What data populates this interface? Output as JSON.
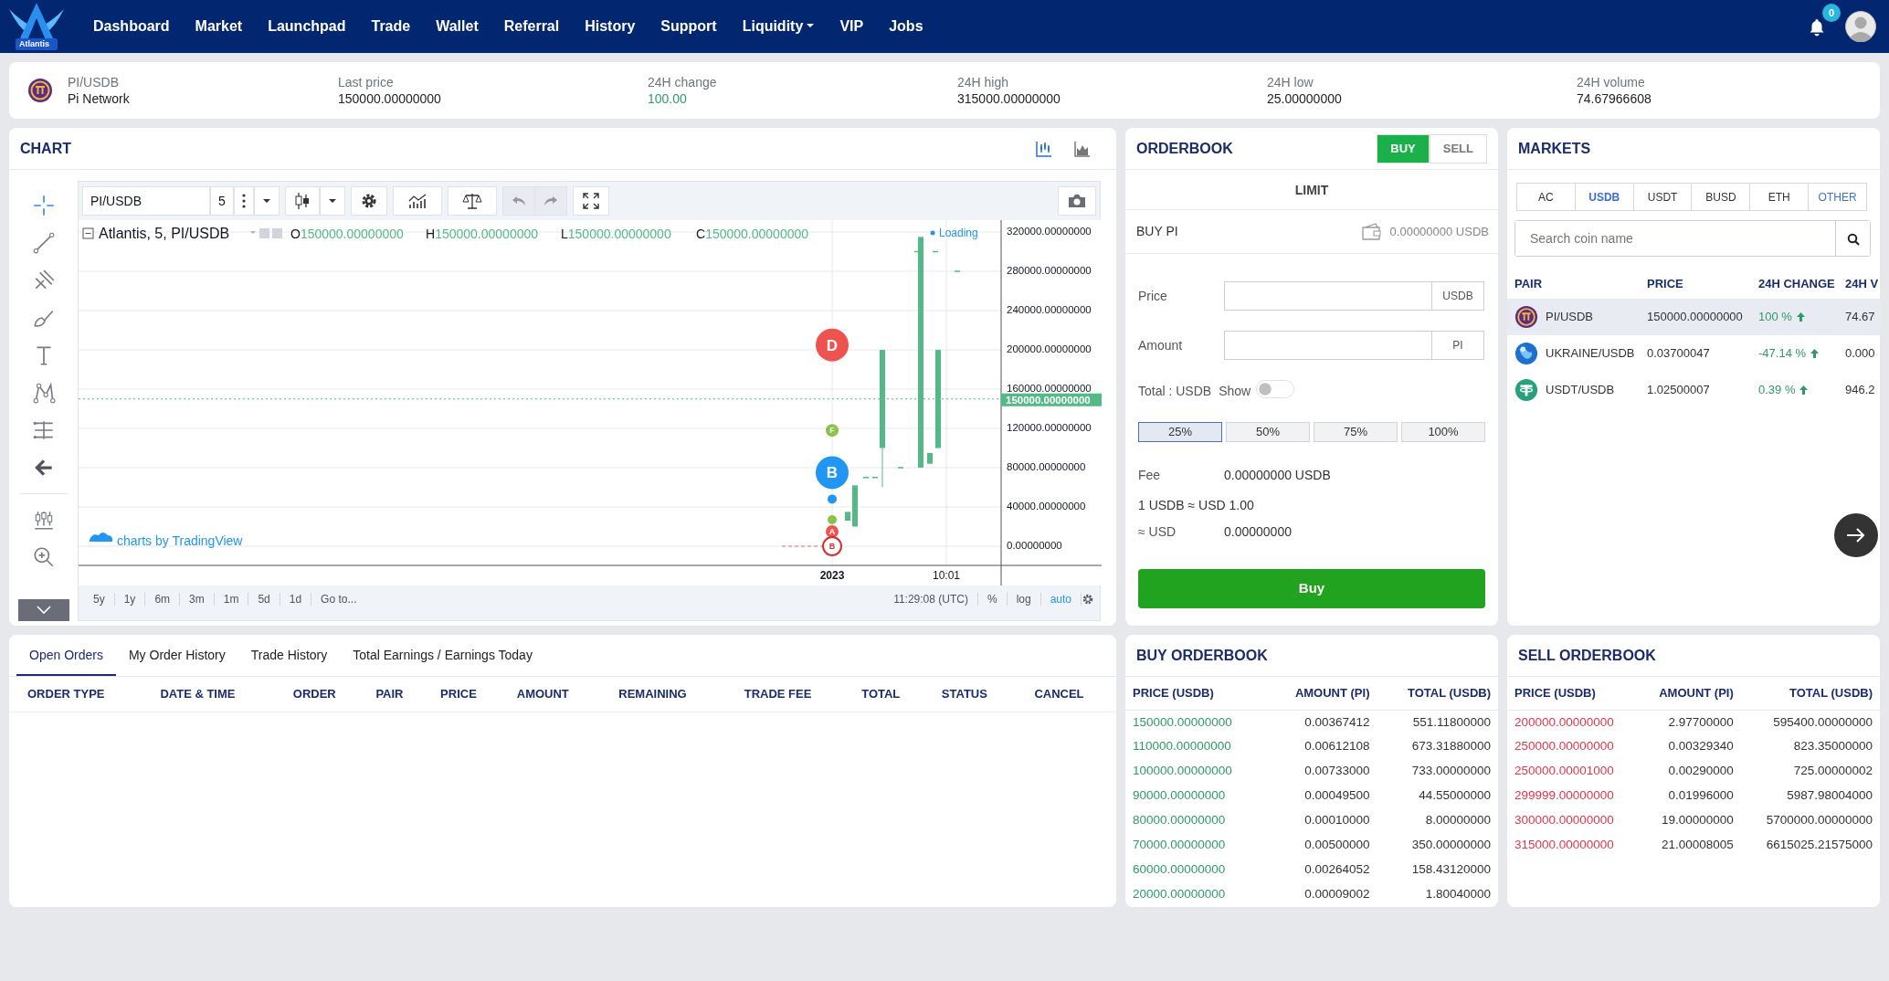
{
  "nav": {
    "brand": "Atlantis",
    "items": [
      {
        "label": "Dashboard",
        "dropdown": false
      },
      {
        "label": "Market",
        "dropdown": false
      },
      {
        "label": "Launchpad",
        "dropdown": false
      },
      {
        "label": "Trade",
        "dropdown": false
      },
      {
        "label": "Wallet",
        "dropdown": false
      },
      {
        "label": "Referral",
        "dropdown": false
      },
      {
        "label": "History",
        "dropdown": false
      },
      {
        "label": "Support",
        "dropdown": false
      },
      {
        "label": "Liquidity",
        "dropdown": true
      },
      {
        "label": "VIP",
        "dropdown": false
      },
      {
        "label": "Jobs",
        "dropdown": false
      }
    ],
    "notification_count": "0"
  },
  "ticker": {
    "pair": "PI/USDB",
    "name": "Pi Network",
    "stats": [
      {
        "label": "Last price",
        "value": "150000.00000000",
        "kind": "plain"
      },
      {
        "label": "24H change",
        "value": "100.00",
        "kind": "up"
      },
      {
        "label": "24H high",
        "value": "315000.00000000",
        "kind": "plain"
      },
      {
        "label": "24H low",
        "value": "25.00000000",
        "kind": "plain"
      },
      {
        "label": "24H volume",
        "value": "74.67966608",
        "kind": "plain"
      }
    ]
  },
  "chart": {
    "title": "CHART",
    "symbol": "PI/USDB",
    "interval": "5",
    "legend": "Atlantis, 5, PI/USDB",
    "ohlc": [
      {
        "key": "O",
        "value": "150000.00000000"
      },
      {
        "key": "H",
        "value": "150000.00000000"
      },
      {
        "key": "L",
        "value": "150000.00000000"
      },
      {
        "key": "C",
        "value": "150000.00000000"
      }
    ],
    "loading": "Loading",
    "watermark": "charts by TradingView",
    "y_labels": [
      "320000.00000000",
      "280000.00000000",
      "240000.00000000",
      "200000.00000000",
      "160000.00000000",
      "120000.00000000",
      "80000.00000000",
      "40000.00000000",
      "0.00000000"
    ],
    "price_tag": "150000.00000000",
    "x_labels": [
      "2023",
      "10:01"
    ],
    "markers": [
      {
        "kind": "large",
        "label": "D",
        "color": "#ef5350"
      },
      {
        "kind": "small",
        "label": "F",
        "color": "#8bc34a"
      },
      {
        "kind": "large",
        "label": "B",
        "color": "#2196f3"
      },
      {
        "kind": "dot",
        "color": "#2196f3"
      },
      {
        "kind": "dot",
        "color": "#8bc34a"
      },
      {
        "kind": "small",
        "label": "A",
        "color": "#ef5350"
      },
      {
        "kind": "outline",
        "label": "B",
        "color": "#d32f2f"
      }
    ],
    "ranges": [
      "5y",
      "1y",
      "6m",
      "3m",
      "1m",
      "5d",
      "1d"
    ],
    "goto": "Go to...",
    "time": "11:29:08 (UTC)",
    "scale_options": [
      {
        "label": "%",
        "selected": false
      },
      {
        "label": "log",
        "selected": false
      },
      {
        "label": "auto",
        "selected": true
      }
    ]
  },
  "orderbook": {
    "title": "ORDERBOOK",
    "sides": [
      {
        "label": "BUY",
        "selected": true
      },
      {
        "label": "SELL",
        "selected": false
      }
    ],
    "mode": "LIMIT",
    "heading": "BUY PI",
    "balance": "0.00000000 USDB",
    "fields": [
      {
        "label": "Price",
        "unit": "USDB"
      },
      {
        "label": "Amount",
        "unit": "PI"
      }
    ],
    "total_label": "Total : USDB",
    "show_label": "Show",
    "show_on": false,
    "percents": [
      {
        "label": "25%",
        "selected": true
      },
      {
        "label": "50%",
        "selected": false
      },
      {
        "label": "75%",
        "selected": false
      },
      {
        "label": "100%",
        "selected": false
      }
    ],
    "fee_label": "Fee",
    "fee": "0.00000000 USDB",
    "rate": "1 USDB ≈ USD 1.00",
    "usd_label": "≈ USD",
    "usd": "0.00000000",
    "submit": "Buy"
  },
  "markets": {
    "title": "MARKETS",
    "tabs": [
      {
        "label": "AC",
        "kind": "tab",
        "selected": false
      },
      {
        "label": "USDB",
        "kind": "tab",
        "selected": true
      },
      {
        "label": "USDT",
        "kind": "tab",
        "selected": false
      },
      {
        "label": "BUSD",
        "kind": "tab",
        "selected": false
      },
      {
        "label": "ETH",
        "kind": "tab",
        "selected": false
      },
      {
        "label": "OTHER",
        "kind": "link",
        "selected": false
      }
    ],
    "search": {
      "placeholder": "Search coin name"
    },
    "columns": [
      "PAIR",
      "PRICE",
      "24H CHANGE",
      "24H V"
    ],
    "rows": [
      {
        "kind": "pi",
        "pair": "PI/USDB",
        "price": "150000.00000000",
        "change": "100 %",
        "volume": "74.67",
        "selected": true
      },
      {
        "kind": "globe",
        "pair": "UKRAINE/USDB",
        "price": "0.03700047",
        "change": "-47.14 %",
        "volume": "0.000",
        "selected": false
      },
      {
        "kind": "tether",
        "pair": "USDT/USDB",
        "price": "1.02500007",
        "change": "0.39 %",
        "volume": "946.2",
        "selected": false
      }
    ]
  },
  "orders": {
    "tabs": [
      {
        "label": "Open Orders",
        "selected": true
      },
      {
        "label": "My Order History",
        "selected": false
      },
      {
        "label": "Trade History",
        "selected": false
      },
      {
        "label": "Total Earnings / Earnings Today",
        "selected": false
      }
    ],
    "columns": [
      "ORDER TYPE",
      "DATE & TIME",
      "ORDER",
      "PAIR",
      "PRICE",
      "AMOUNT",
      "REMAINING",
      "TRADE FEE",
      "TOTAL",
      "STATUS",
      "CANCEL"
    ]
  },
  "books": [
    {
      "title": "BUY ORDERBOOK",
      "kind": "buy",
      "columns": [
        "PRICE (USDB)",
        "AMOUNT (PI)",
        "TOTAL (USDB)"
      ],
      "rows": [
        {
          "price": "150000.00000000",
          "amount": "0.00367412",
          "total": "551.11800000"
        },
        {
          "price": "110000.00000000",
          "amount": "0.00612108",
          "total": "673.31880000"
        },
        {
          "price": "100000.00000000",
          "amount": "0.00733000",
          "total": "733.00000000"
        },
        {
          "price": "90000.00000000",
          "amount": "0.00049500",
          "total": "44.55000000"
        },
        {
          "price": "80000.00000000",
          "amount": "0.00010000",
          "total": "8.00000000"
        },
        {
          "price": "70000.00000000",
          "amount": "0.00500000",
          "total": "350.00000000"
        },
        {
          "price": "60000.00000000",
          "amount": "0.00264052",
          "total": "158.43120000"
        },
        {
          "price": "20000.00000000",
          "amount": "0.00009002",
          "total": "1.80040000"
        }
      ]
    },
    {
      "title": "SELL ORDERBOOK",
      "kind": "sell",
      "columns": [
        "PRICE (USDB)",
        "AMOUNT (PI)",
        "TOTAL (USDB)"
      ],
      "rows": [
        {
          "price": "200000.00000000",
          "amount": "2.97700000",
          "total": "595400.00000000"
        },
        {
          "price": "250000.00000000",
          "amount": "0.00329340",
          "total": "823.35000000"
        },
        {
          "price": "250000.00001000",
          "amount": "0.00290000",
          "total": "725.00000002"
        },
        {
          "price": "299999.00000000",
          "amount": "0.01996000",
          "total": "5987.98004000"
        },
        {
          "price": "300000.00000000",
          "amount": "19.00000000",
          "total": "5700000.00000000"
        },
        {
          "price": "315000.00000000",
          "amount": "21.00008005",
          "total": "6615025.21575000"
        }
      ]
    }
  ]
}
